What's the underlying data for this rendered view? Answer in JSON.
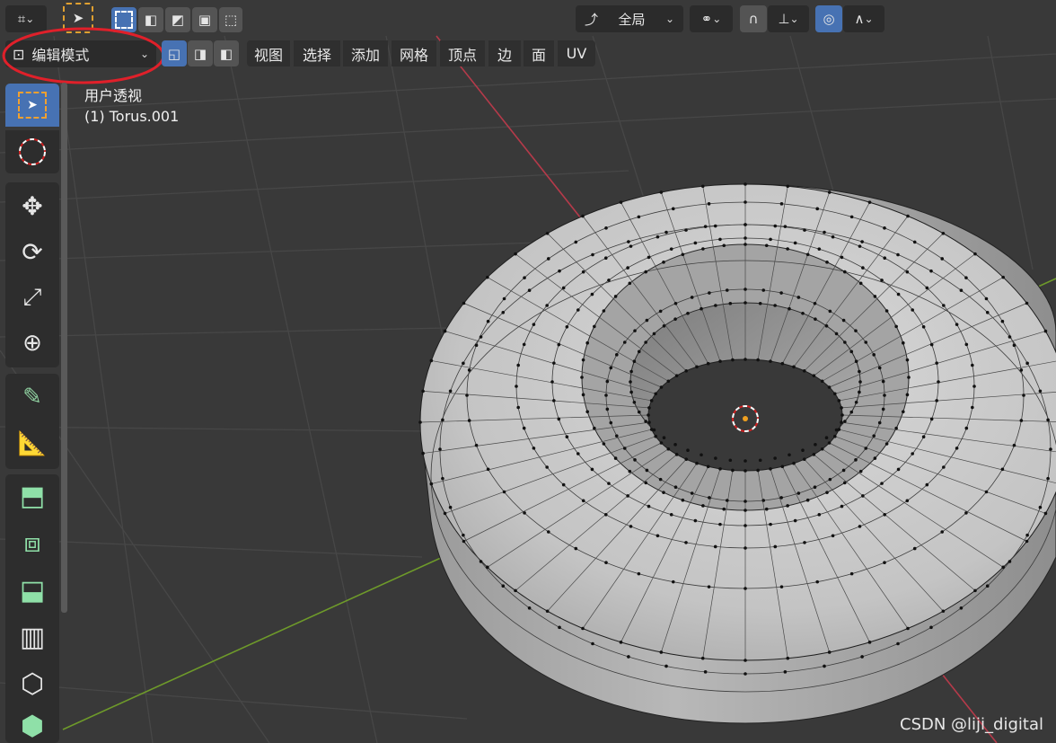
{
  "header": {
    "orientation_label": "全局",
    "mode_select": "编辑模式"
  },
  "menu": {
    "items": [
      "视图",
      "选择",
      "添加",
      "网格",
      "顶点",
      "边",
      "面",
      "UV"
    ]
  },
  "viewport": {
    "view_name": "用户透视",
    "object_name": "(1) Torus.001"
  },
  "watermark": "CSDN @liji_digital",
  "colors": {
    "accent": "#4772b3",
    "x_axis": "#c0394a",
    "y_axis": "#7aa62a",
    "highlight_circle": "#e0202a",
    "mesh": "#b8b8b8"
  },
  "icons": {
    "toolbar": [
      "select-box-icon",
      "cursor-icon",
      "move-icon",
      "rotate-icon",
      "scale-icon",
      "transform-icon",
      "annotate-icon",
      "measure-icon",
      "add-cube-icon",
      "extrude-icon",
      "inset-icon",
      "bevel-icon",
      "loop-cut-icon",
      "knife-icon",
      "poly-build-icon"
    ]
  }
}
